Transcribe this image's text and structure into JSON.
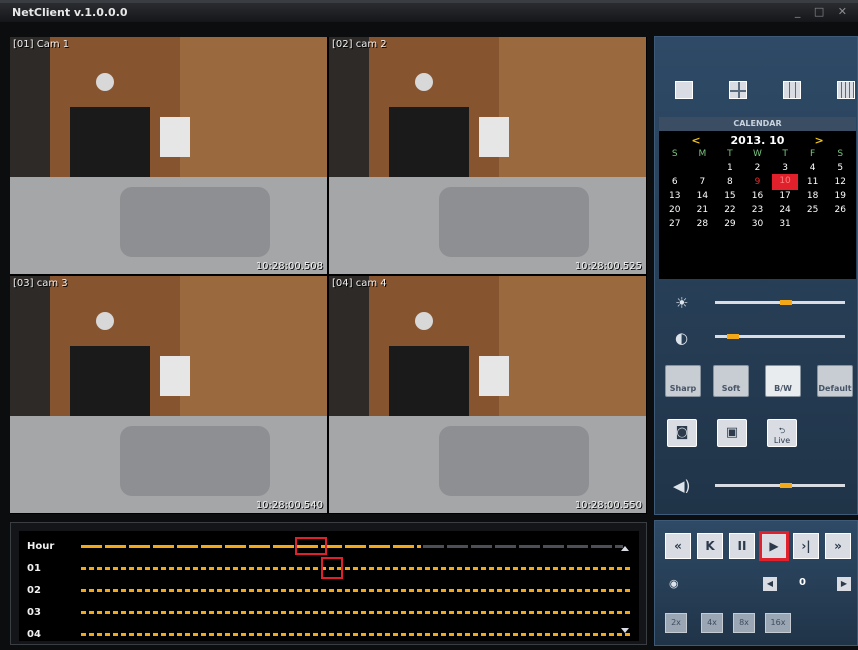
{
  "window": {
    "title": "NetClient  v.1.0.0.0",
    "controls": "_ □ ✕"
  },
  "cameras": [
    {
      "label": "[01] Cam 1",
      "timestamp": "10:28:00.508"
    },
    {
      "label": "[02] cam 2",
      "timestamp": "10:28:00.525"
    },
    {
      "label": "[03] cam 3",
      "timestamp": "10:28:00.540"
    },
    {
      "label": "[04] cam 4",
      "timestamp": "10:28:00.550"
    }
  ],
  "layout_icons": [
    "single-view-icon",
    "quad-view-icon",
    "nine-view-icon",
    "sixteen-view-icon"
  ],
  "calendar": {
    "header": "CALENDAR",
    "month": "2013. 10",
    "prev": "<",
    "next": ">",
    "weekdays": [
      "S",
      "M",
      "T",
      "W",
      "T",
      "F",
      "S"
    ],
    "weeks": [
      [
        "",
        "",
        "1",
        "2",
        "3",
        "4",
        "5"
      ],
      [
        "6",
        "7",
        "8",
        "9",
        "10",
        "11",
        "12"
      ],
      [
        "13",
        "14",
        "15",
        "16",
        "17",
        "18",
        "19"
      ],
      [
        "20",
        "21",
        "22",
        "23",
        "24",
        "25",
        "26"
      ],
      [
        "27",
        "28",
        "29",
        "30",
        "31",
        "",
        ""
      ]
    ],
    "red_day": "9",
    "selected_day": "10"
  },
  "adjustments": {
    "brightness_level": 0.55,
    "contrast_level": 0.1,
    "volume_level": 0.55
  },
  "filters": [
    {
      "label": "Sharp",
      "icon": "triangle-icon"
    },
    {
      "label": "Soft",
      "icon": "drop-icon"
    },
    {
      "label": "B/W",
      "icon": "picture-icon"
    },
    {
      "label": "Default",
      "icon": "picture-icon"
    }
  ],
  "actions": {
    "live_label": "Live"
  },
  "timeline": {
    "rows": [
      "Hour",
      "01",
      "02",
      "03",
      "04"
    ]
  },
  "playback": {
    "buttons": [
      "«",
      "K",
      "II",
      "▶",
      "›|",
      "»"
    ],
    "active": "▶",
    "channel_value": "0",
    "speeds": [
      "2x",
      "4x",
      "8x",
      "16x"
    ]
  }
}
